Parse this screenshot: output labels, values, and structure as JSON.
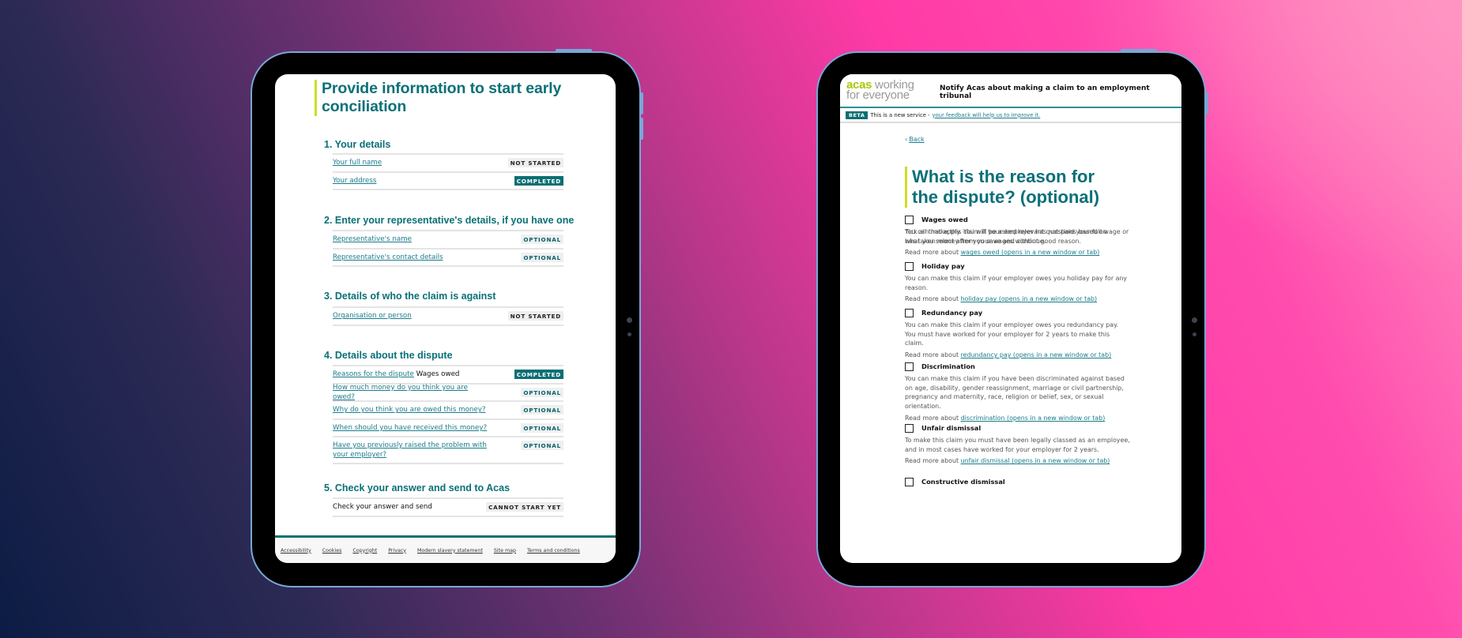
{
  "colors": {
    "brand_teal": "#0a6f73",
    "heading_teal": "#0a7078",
    "link_teal": "#1b7c8a",
    "accent_lime": "#cfdd24",
    "logo_green": "#a9c80a",
    "tablet_frame": "#7aa6d6"
  },
  "left_tablet": {
    "page_title": "Provide information to start early conciliation",
    "sections": [
      {
        "heading": "1. Your details",
        "rows": [
          {
            "label": "Your full name",
            "suffix": "",
            "status": "NOT STARTED",
            "status_kind": "not-started",
            "link": true
          },
          {
            "label": "Your address",
            "suffix": "",
            "status": "COMPLETED",
            "status_kind": "completed",
            "link": true
          }
        ]
      },
      {
        "heading": "2. Enter your representative's details, if you have one",
        "rows": [
          {
            "label": "Representative's name",
            "suffix": "",
            "status": "OPTIONAL",
            "status_kind": "optional",
            "link": true
          },
          {
            "label": "Representative's contact details",
            "suffix": "",
            "status": "OPTIONAL",
            "status_kind": "optional",
            "link": true
          }
        ]
      },
      {
        "heading": "3. Details of who the claim is against",
        "rows": [
          {
            "label": "Organisation or person",
            "suffix": "",
            "status": "NOT STARTED",
            "status_kind": "not-started",
            "link": true
          }
        ]
      },
      {
        "heading": "4. Details about the dispute",
        "rows": [
          {
            "label": "Reasons for the dispute",
            "suffix": "Wages owed",
            "status": "COMPLETED",
            "status_kind": "completed",
            "link": true
          },
          {
            "label": "How much money do you think you are owed?",
            "suffix": "",
            "status": "OPTIONAL",
            "status_kind": "optional",
            "link": true
          },
          {
            "label": "Why do you think you are owed this money?",
            "suffix": "",
            "status": "OPTIONAL",
            "status_kind": "optional",
            "link": true
          },
          {
            "label": "When should you have received this money?",
            "suffix": "",
            "status": "OPTIONAL",
            "status_kind": "optional",
            "link": true
          },
          {
            "label": "Have you previously raised the problem with your employer?",
            "suffix": "",
            "status": "OPTIONAL",
            "status_kind": "optional",
            "link": true
          }
        ]
      },
      {
        "heading": "5. Check your answer and send to Acas",
        "rows": [
          {
            "label": "Check your answer and send",
            "suffix": "",
            "status": "CANNOT START YET",
            "status_kind": "cannot-start",
            "link": false
          }
        ]
      }
    ],
    "footer_links": [
      "Accessibility",
      "Cookies",
      "Copyright",
      "Privacy",
      "Modern slavery statement",
      "Site map",
      "Terms and conditions"
    ]
  },
  "right_tablet": {
    "logo": {
      "brand": "acas",
      "tagline_1": " working",
      "tagline_2": "for everyone"
    },
    "header_title": "Notify Acas about making a claim to an employment tribunal",
    "beta": {
      "tag": "BETA",
      "text": "This is a new service -",
      "link": "your feedback will help us to improve it."
    },
    "back_label": "Back",
    "page_title": "What is the reason for the dispute? (optional)",
    "intro": "Tick all that apply. You will be asked relevant questions based on what you select after you save and continue.",
    "read_more_prefix": "Read more about",
    "options": [
      {
        "label": "Wages owed",
        "checked": false,
        "description": "You can make this claim if your employer has not paid your full wage or has taken money from your wages without good reason.",
        "link": "wages owed (opens in a new window or tab)"
      },
      {
        "label": "Holiday pay",
        "checked": false,
        "description": "You can make this claim if your employer owes you holiday pay for any reason.",
        "link": "holiday pay (opens in a new window or tab)"
      },
      {
        "label": "Redundancy pay",
        "checked": false,
        "description": "You can make this claim if your employer owes you redundancy pay. You must have worked for your employer for 2 years to make this claim.",
        "link": "redundancy pay (opens in a new window or tab)"
      },
      {
        "label": "Discrimination",
        "checked": false,
        "description": "You can make this claim if you have been discriminated against based on age, disability, gender reassignment, marriage or civil partnership, pregnancy and maternity, race, religion or belief, sex, or sexual orientation.",
        "link": "discrimination (opens in a new window or tab)"
      },
      {
        "label": "Unfair dismissal",
        "checked": false,
        "description": "To make this claim you must have been legally classed as an employee, and in most cases have worked for your employer for 2 years.",
        "link": "unfair dismissal (opens in a new window or tab)"
      },
      {
        "label": "Constructive dismissal",
        "checked": false,
        "description": "",
        "link": ""
      }
    ]
  }
}
